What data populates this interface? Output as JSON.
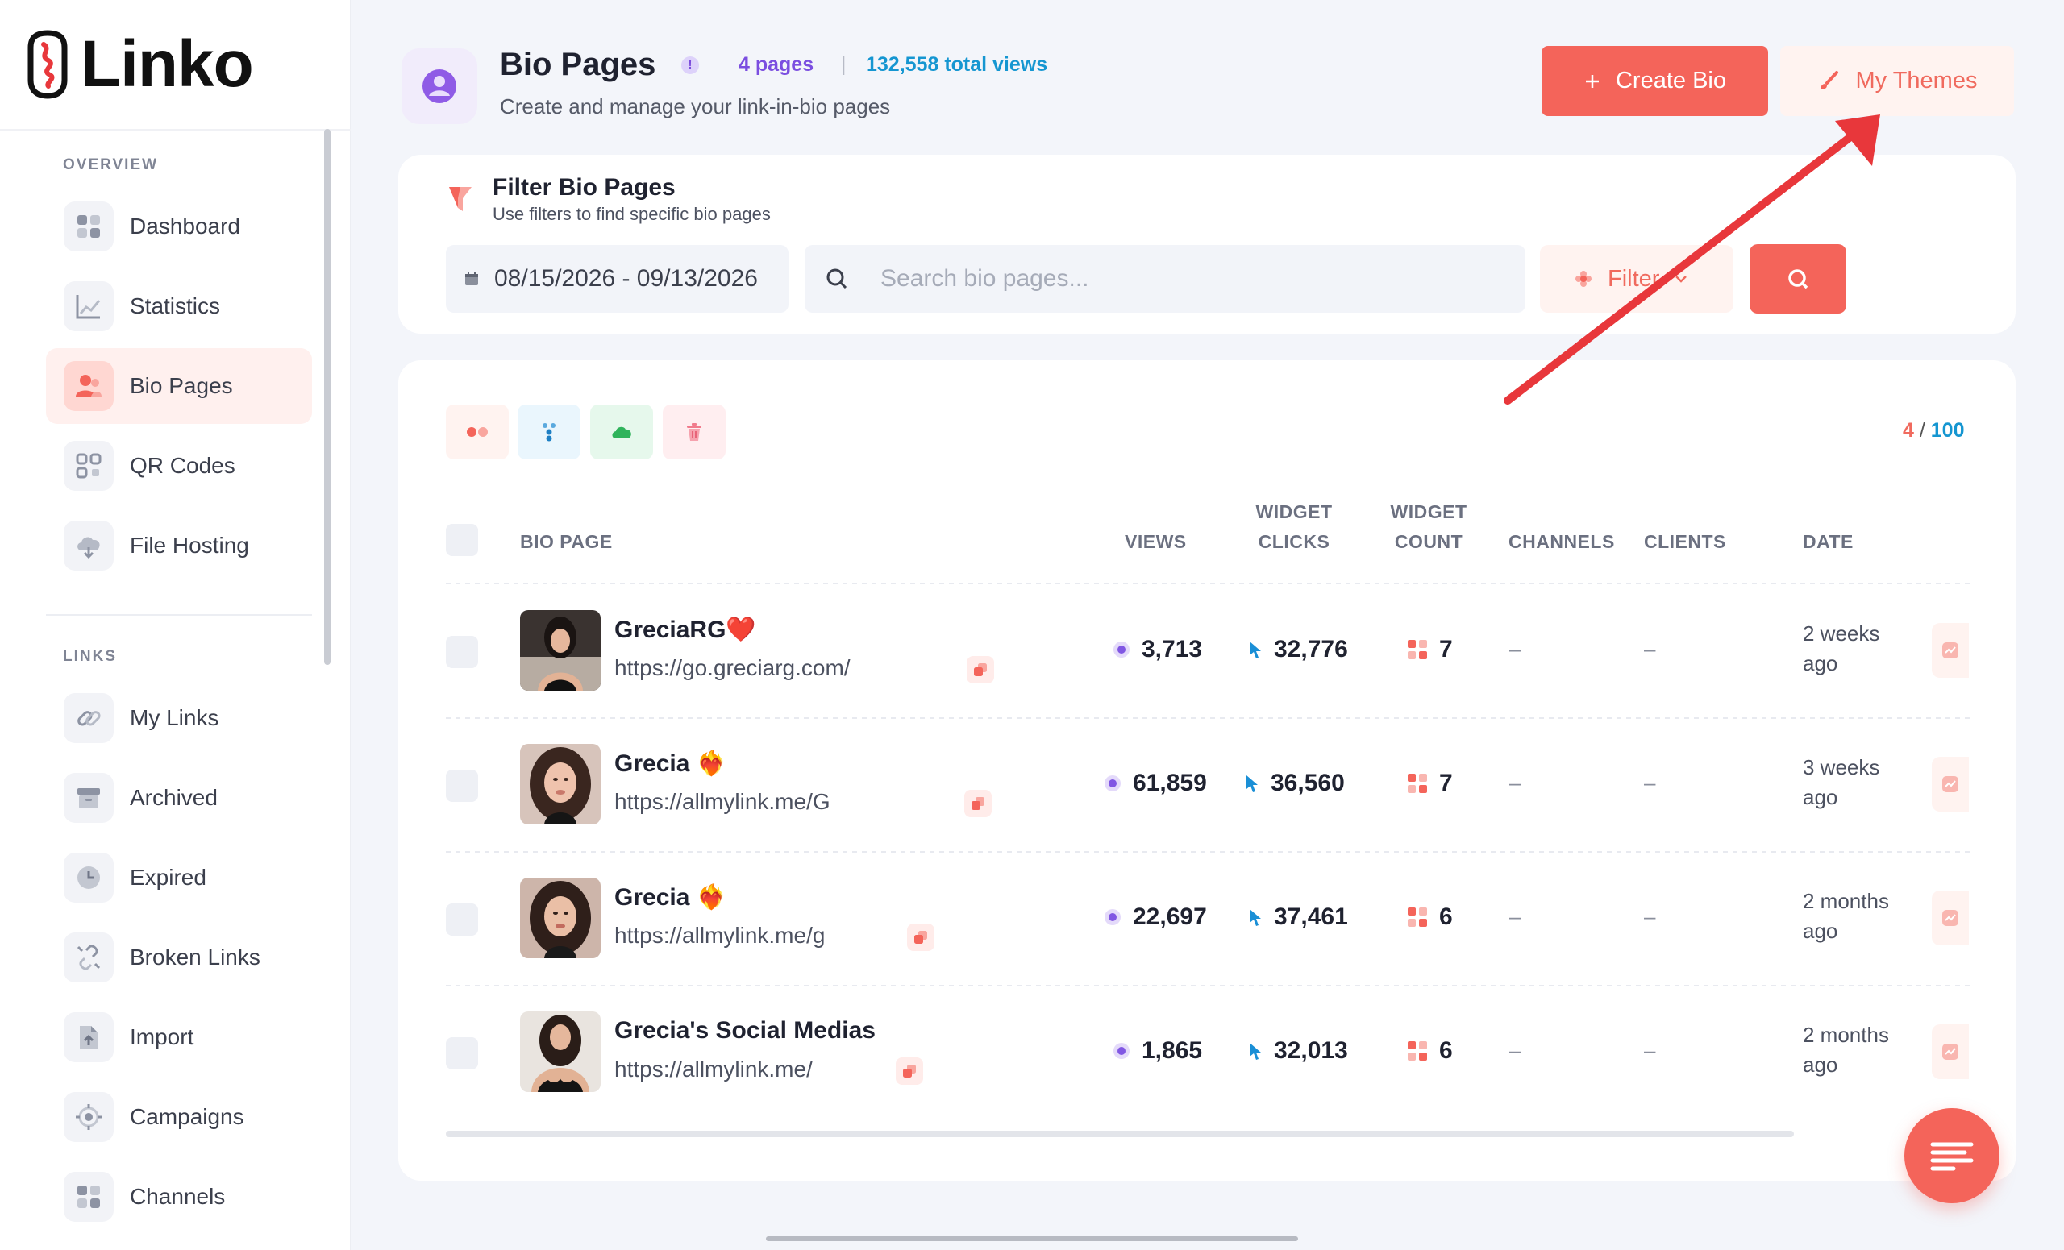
{
  "app": {
    "name": "Linko"
  },
  "sidebar": {
    "sections": [
      {
        "label": "OVERVIEW"
      },
      {
        "label": "LINKS"
      }
    ],
    "items": [
      {
        "label": "Dashboard",
        "icon": "dashboard-icon"
      },
      {
        "label": "Statistics",
        "icon": "chart-icon"
      },
      {
        "label": "Bio Pages",
        "icon": "users-icon",
        "active": true
      },
      {
        "label": "QR Codes",
        "icon": "qr-code-icon"
      },
      {
        "label": "File Hosting",
        "icon": "cloud-icon"
      },
      {
        "label": "My Links",
        "icon": "link-icon"
      },
      {
        "label": "Archived",
        "icon": "archive-icon"
      },
      {
        "label": "Expired",
        "icon": "clock-icon"
      },
      {
        "label": "Broken Links",
        "icon": "broken-link-icon"
      },
      {
        "label": "Import",
        "icon": "import-icon"
      },
      {
        "label": "Campaigns",
        "icon": "target-icon"
      },
      {
        "label": "Channels",
        "icon": "grid-icon"
      }
    ]
  },
  "header": {
    "title": "Bio Pages",
    "pages_count": "4 pages",
    "separator": "|",
    "total_views": "132,558 total views",
    "subtitle": "Create and manage your link-in-bio pages",
    "create_label": "Create Bio",
    "themes_label": "My Themes"
  },
  "filter": {
    "title": "Filter Bio Pages",
    "subtitle": "Use filters to find specific bio pages",
    "date_range": "08/15/2026 - 09/13/2026",
    "search_placeholder": "Search bio pages...",
    "filter_label": "Filter"
  },
  "table": {
    "count_used": "4",
    "count_sep": "/",
    "count_total": "100",
    "headers": {
      "bio_page": "BIO PAGE",
      "views": "VIEWS",
      "widget_clicks_1": "WIDGET",
      "widget_clicks_2": "CLICKS",
      "widget_count_1": "WIDGET",
      "widget_count_2": "COUNT",
      "channels": "CHANNELS",
      "clients": "CLIENTS",
      "date": "DATE"
    },
    "rows": [
      {
        "name": "GreciaRG❤️",
        "url": "https://go.greciarg.com/",
        "views": "3,713",
        "clicks": "32,776",
        "widgets": "7",
        "channels": "–",
        "clients": "–",
        "date_1": "2 weeks",
        "date_2": "ago"
      },
      {
        "name": "Grecia ❤️‍🔥",
        "url": "https://allmylink.me/G",
        "views": "61,859",
        "clicks": "36,560",
        "widgets": "7",
        "channels": "–",
        "clients": "–",
        "date_1": "3 weeks",
        "date_2": "ago"
      },
      {
        "name": "Grecia ❤️‍🔥",
        "url": "https://allmylink.me/g",
        "views": "22,697",
        "clicks": "37,461",
        "widgets": "6",
        "channels": "–",
        "clients": "–",
        "date_1": "2 months",
        "date_2": "ago"
      },
      {
        "name": "Grecia's Social Medias",
        "url": "https://allmylink.me/",
        "views": "1,865",
        "clicks": "32,013",
        "widgets": "6",
        "channels": "–",
        "clients": "–",
        "date_1": "2 months",
        "date_2": "ago"
      }
    ]
  },
  "colors": {
    "accent": "#f4645a",
    "purple": "#7b4ee0",
    "blue": "#1596d1",
    "annotation_arrow": "#e8373b"
  }
}
